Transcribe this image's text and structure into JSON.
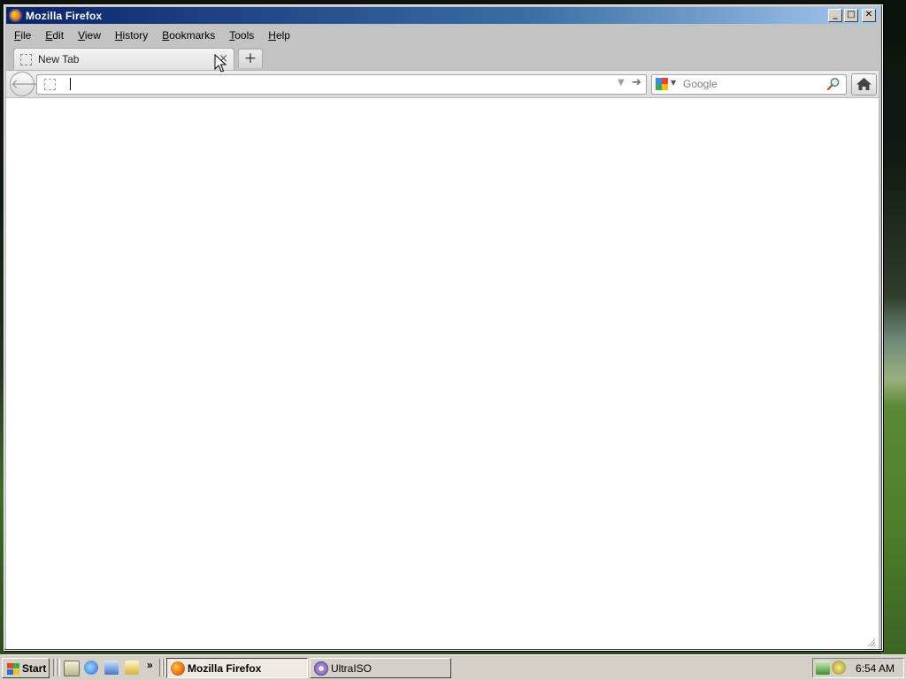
{
  "window": {
    "title": "Mozilla Firefox",
    "buttons": {
      "minimize": "_",
      "maximize": "□",
      "close": "✕"
    }
  },
  "menubar": {
    "items": [
      {
        "label": "File",
        "key": "F",
        "rest": "ile"
      },
      {
        "label": "Edit",
        "key": "E",
        "rest": "dit"
      },
      {
        "label": "View",
        "key": "V",
        "rest": "iew"
      },
      {
        "label": "History",
        "key": "H",
        "rest": "istory"
      },
      {
        "label": "Bookmarks",
        "key": "B",
        "rest": "ookmarks"
      },
      {
        "label": "Tools",
        "key": "T",
        "rest": "ools"
      },
      {
        "label": "Help",
        "key": "H",
        "rest": "elp"
      }
    ]
  },
  "tabs": [
    {
      "label": "New Tab",
      "close": "×",
      "active": true
    }
  ],
  "newtab": {
    "label": "+"
  },
  "navbar": {
    "back": "🡐",
    "url": {
      "value": "",
      "dropmarker": "▼",
      "go": "➔"
    },
    "search": {
      "placeholder": "Google",
      "engine_drop": "▼"
    }
  },
  "taskbar": {
    "start_label": "Start",
    "more": "»",
    "tasks": [
      {
        "label": "Mozilla Firefox",
        "active": true
      },
      {
        "label": "UltraISO",
        "active": false
      }
    ],
    "clock": "6:54 AM"
  },
  "icons": {
    "app": "firefox-icon",
    "page": "blank-page-icon",
    "search_engine": "google-icon",
    "search": "magnifier-icon",
    "home": "home-icon"
  },
  "colors": {
    "titlebar_start": "#0a246a",
    "titlebar_end": "#a6caf0",
    "chrome": "#c3c3c3",
    "taskbar": "#d4d0c8"
  }
}
